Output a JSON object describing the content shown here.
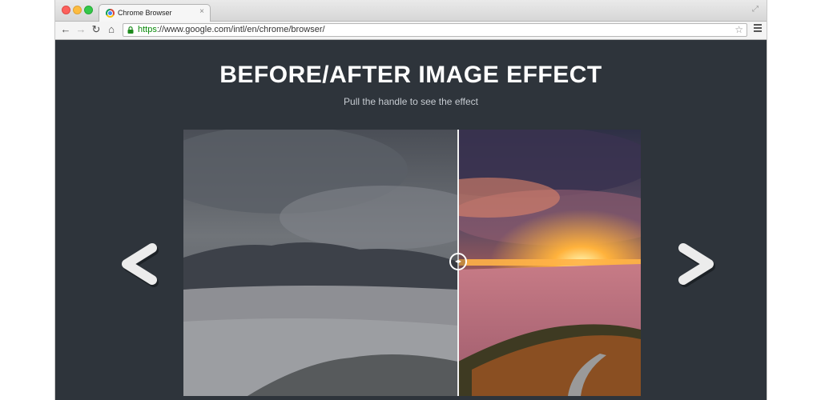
{
  "browser": {
    "tab_title": "Chrome Browser",
    "tab_close": "×",
    "url_scheme": "https",
    "url_rest": "://www.google.com/intl/en/chrome/browser/"
  },
  "page": {
    "headline": "BEFORE/AFTER IMAGE EFFECT",
    "subtitle": "Pull the handle to see the effect"
  },
  "slider": {
    "position": 0.6
  },
  "colors": {
    "page_background": "#2e343b",
    "headline": "#ffffff",
    "subtitle": "#c6cbd1"
  },
  "icons": [
    "back-icon",
    "forward-icon",
    "reload-icon",
    "home-icon",
    "lock-icon",
    "star-icon",
    "menu-icon",
    "prev-arrow-icon",
    "next-arrow-icon"
  ]
}
